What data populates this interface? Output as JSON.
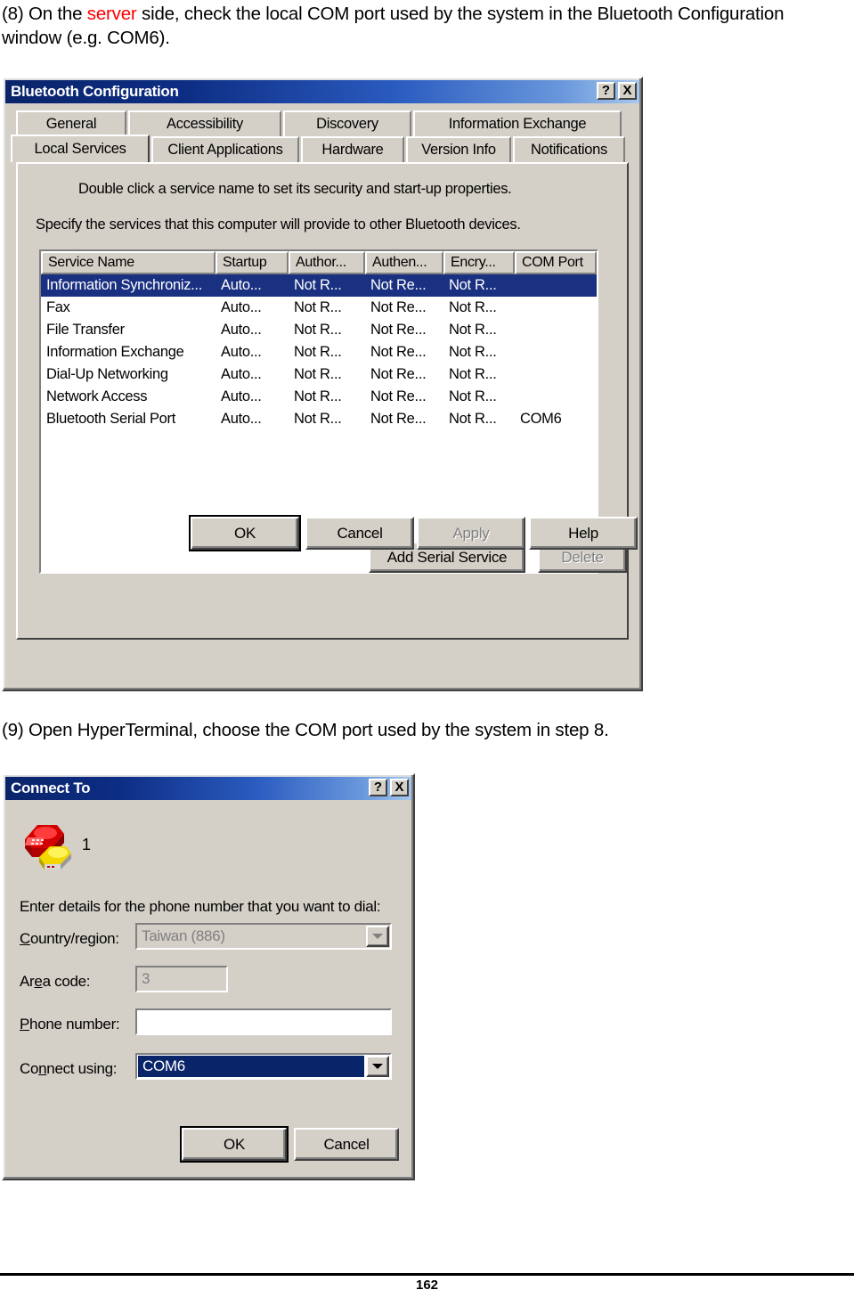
{
  "document": {
    "step8": {
      "prefix": "(8) On the ",
      "accent": "server",
      "suffix": " side, check the local COM port used by the system in the Bluetooth Configuration window (e.g. COM6)."
    },
    "step9": "(9) Open HyperTerminal, choose the COM port used by the system in step 8.",
    "page_number": "162"
  },
  "bluetooth_dialog": {
    "title": "Bluetooth Configuration",
    "help_button": "?",
    "close_button": "X",
    "tabs_row1": [
      {
        "label": "General",
        "selected": false
      },
      {
        "label": "Accessibility",
        "selected": false
      },
      {
        "label": "Discovery",
        "selected": false
      },
      {
        "label": "Information Exchange",
        "selected": false
      }
    ],
    "tabs_row2": [
      {
        "label": "Local Services",
        "selected": true
      },
      {
        "label": "Client Applications",
        "selected": false
      },
      {
        "label": "Hardware",
        "selected": false
      },
      {
        "label": "Version Info",
        "selected": false
      },
      {
        "label": "Notifications",
        "selected": false
      }
    ],
    "hint_doubleclick": "Double click a service name to set its security and start-up properties.",
    "hint_specify": "Specify the services that this computer will provide to other Bluetooth devices.",
    "table": {
      "columns": [
        "Service Name",
        "Startup",
        "Author...",
        "Authen...",
        "Encry...",
        "COM Port"
      ],
      "rows": [
        {
          "selected": true,
          "cells": [
            "Information Synchroniz...",
            "Auto...",
            "Not R...",
            "Not Re...",
            "Not R...",
            ""
          ]
        },
        {
          "selected": false,
          "cells": [
            "Fax",
            "Auto...",
            "Not R...",
            "Not Re...",
            "Not R...",
            ""
          ]
        },
        {
          "selected": false,
          "cells": [
            "File Transfer",
            "Auto...",
            "Not R...",
            "Not Re...",
            "Not R...",
            ""
          ]
        },
        {
          "selected": false,
          "cells": [
            "Information Exchange",
            "Auto...",
            "Not R...",
            "Not Re...",
            "Not R...",
            ""
          ]
        },
        {
          "selected": false,
          "cells": [
            "Dial-Up Networking",
            "Auto...",
            "Not R...",
            "Not Re...",
            "Not R...",
            ""
          ]
        },
        {
          "selected": false,
          "cells": [
            "Network Access",
            "Auto...",
            "Not R...",
            "Not Re...",
            "Not R...",
            ""
          ]
        },
        {
          "selected": false,
          "cells": [
            "Bluetooth Serial Port",
            "Auto...",
            "Not R...",
            "Not Re...",
            "Not R...",
            "COM6"
          ]
        }
      ]
    },
    "buttons": {
      "add_serial_service": "Add Serial Service",
      "delete": "Delete",
      "ok": "OK",
      "cancel": "Cancel",
      "apply": "Apply",
      "help": "Help"
    }
  },
  "connect_dialog": {
    "title": "Connect To",
    "help_button": "?",
    "close_button": "X",
    "connection_name": "1",
    "prompt": "Enter details for the phone number that you want to dial:",
    "fields": {
      "country_label": "Country/region:",
      "country_value": "Taiwan (886)",
      "area_label": "Area code:",
      "area_value": "3",
      "phone_label": "Phone number:",
      "phone_value": "",
      "connect_label": "Connect using:",
      "connect_value": "COM6"
    },
    "buttons": {
      "ok": "OK",
      "cancel": "Cancel"
    }
  },
  "colors": {
    "accent_red": "#ff0000",
    "title_gradient_start": "#0a246a",
    "title_gradient_end": "#a6c8ee",
    "selection_blue": "#1a3080",
    "dialog_face": "#d4d0c8"
  }
}
